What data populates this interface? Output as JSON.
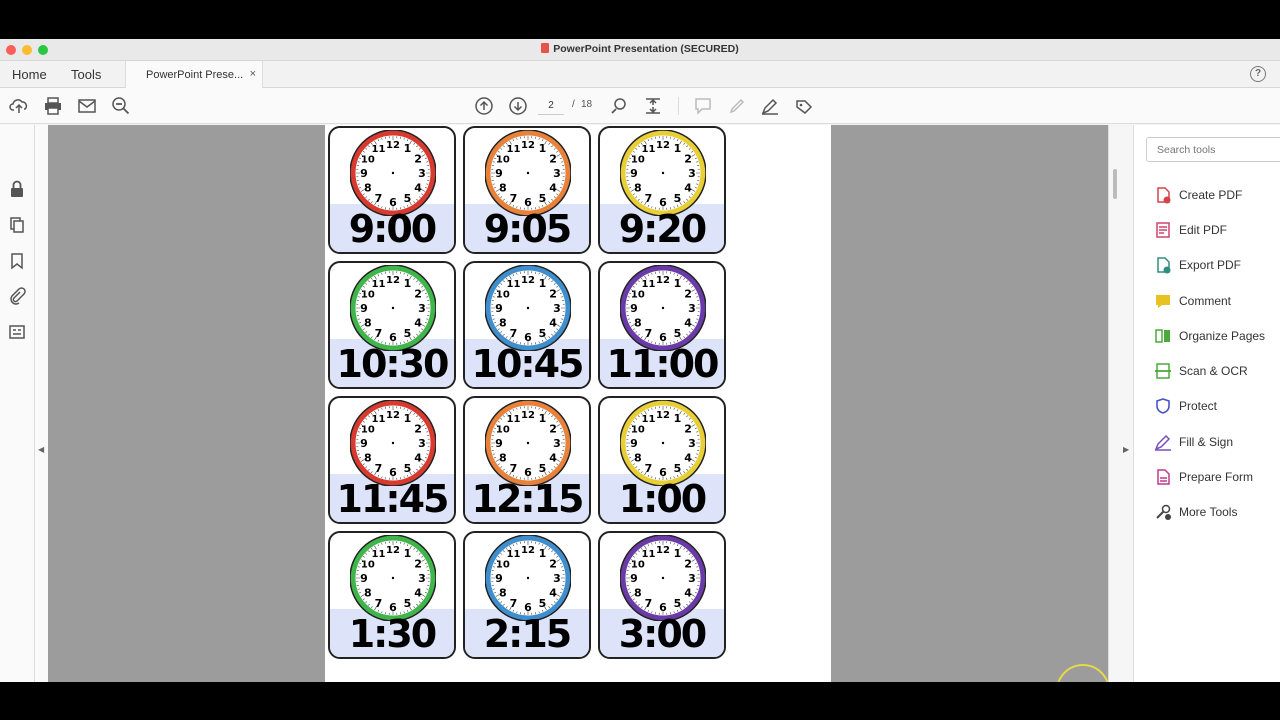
{
  "window": {
    "title": "PowerPoint Presentation (SECURED)"
  },
  "tabs": {
    "home": "Home",
    "tools": "Tools",
    "document_tab": "PowerPoint Prese...",
    "close_glyph": "×",
    "help_glyph": "?"
  },
  "toolbar": {
    "current_page": "2",
    "page_separator": "/",
    "total_pages": "18",
    "icons": [
      "upload-icon",
      "print-icon",
      "mail-icon",
      "zoom-out-icon",
      "page-up-icon",
      "page-down-icon",
      "find-icon",
      "fit-icon",
      "comment-icon",
      "highlight-icon",
      "sign-icon",
      "tag-icon"
    ]
  },
  "left_rail": {
    "icons": [
      "lock-icon",
      "pages-icon",
      "bookmark-icon",
      "attachment-icon",
      "layers-icon"
    ]
  },
  "document": {
    "cards": [
      {
        "time": "9:00",
        "color": "#d93a30"
      },
      {
        "time": "9:05",
        "color": "#e8823a"
      },
      {
        "time": "9:20",
        "color": "#e7cf35"
      },
      {
        "time": "10:30",
        "color": "#3fb54a"
      },
      {
        "time": "10:45",
        "color": "#3f8fcf"
      },
      {
        "time": "11:00",
        "color": "#6a3aa8"
      },
      {
        "time": "11:45",
        "color": "#d93a30"
      },
      {
        "time": "12:15",
        "color": "#e8823a"
      },
      {
        "time": "1:00",
        "color": "#e7cf35"
      },
      {
        "time": "1:30",
        "color": "#3fb54a"
      },
      {
        "time": "2:15",
        "color": "#3f8fcf"
      },
      {
        "time": "3:00",
        "color": "#6a3aa8"
      }
    ]
  },
  "right_panel": {
    "search_placeholder": "Search tools",
    "tools": [
      {
        "label": "Create PDF",
        "icon": "create-pdf-icon",
        "color": "#d6444a"
      },
      {
        "label": "Edit PDF",
        "icon": "edit-pdf-icon",
        "color": "#d2426b"
      },
      {
        "label": "Export PDF",
        "icon": "export-pdf-icon",
        "color": "#2f8f7f"
      },
      {
        "label": "Comment",
        "icon": "comment-icon",
        "color": "#e8c21f"
      },
      {
        "label": "Organize Pages",
        "icon": "organize-pages-icon",
        "color": "#4caa3c"
      },
      {
        "label": "Scan & OCR",
        "icon": "scan-ocr-icon",
        "color": "#4caa3c"
      },
      {
        "label": "Protect",
        "icon": "protect-icon",
        "color": "#4a56c8"
      },
      {
        "label": "Fill & Sign",
        "icon": "fill-sign-icon",
        "color": "#7a4fc0"
      },
      {
        "label": "Prepare Form",
        "icon": "prepare-form-icon",
        "color": "#c03a8a"
      },
      {
        "label": "More Tools",
        "icon": "more-tools-icon",
        "color": "#444444"
      }
    ]
  },
  "colors": {
    "card_band": "#dde3f8",
    "doc_background": "#9c9c9c",
    "cursor_ring": "#e6d84a"
  }
}
